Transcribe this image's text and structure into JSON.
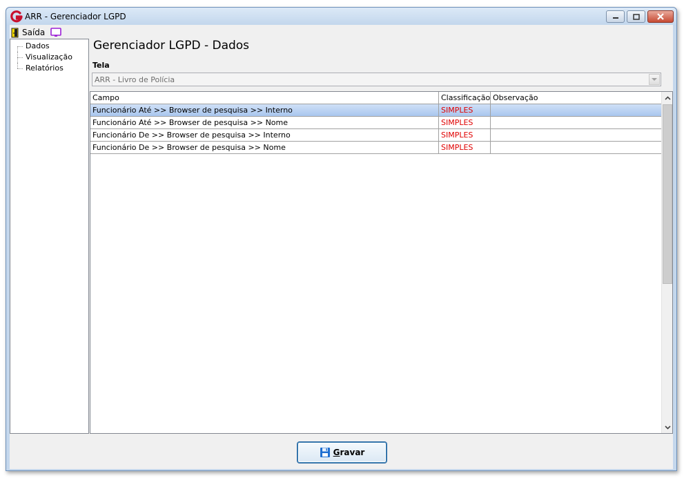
{
  "window": {
    "title": "ARR - Gerenciador LGPD"
  },
  "menu": {
    "exit_label": "Saída"
  },
  "tree": {
    "items": [
      {
        "label": "Dados"
      },
      {
        "label": "Visualização"
      },
      {
        "label": "Relatórios"
      }
    ]
  },
  "main": {
    "title": "Gerenciador LGPD - Dados",
    "screen_label": "Tela",
    "screen_value": "ARR - Livro de Polícia"
  },
  "grid": {
    "headers": {
      "campo": "Campo",
      "classificacao": "Classificação",
      "observacao": "Observação"
    },
    "rows": [
      {
        "campo": "Funcionário Até >> Browser de pesquisa >> Interno",
        "classificacao": "SIMPLES",
        "observacao": ""
      },
      {
        "campo": "Funcionário Até >> Browser de pesquisa >> Nome",
        "classificacao": "SIMPLES",
        "observacao": ""
      },
      {
        "campo": "Funcionário De >> Browser de pesquisa >> Interno",
        "classificacao": "SIMPLES",
        "observacao": ""
      },
      {
        "campo": "Funcionário De >> Browser de pesquisa >> Nome",
        "classificacao": "SIMPLES",
        "observacao": ""
      }
    ]
  },
  "footer": {
    "save_mnemonic": "G",
    "save_rest": "ravar"
  },
  "colors": {
    "classification_red": "#e00000",
    "selection_blue": "#a9c6ee"
  },
  "icons": [
    "app-logo-icon",
    "exit-door-icon",
    "screen-icon",
    "save-disk-icon"
  ]
}
